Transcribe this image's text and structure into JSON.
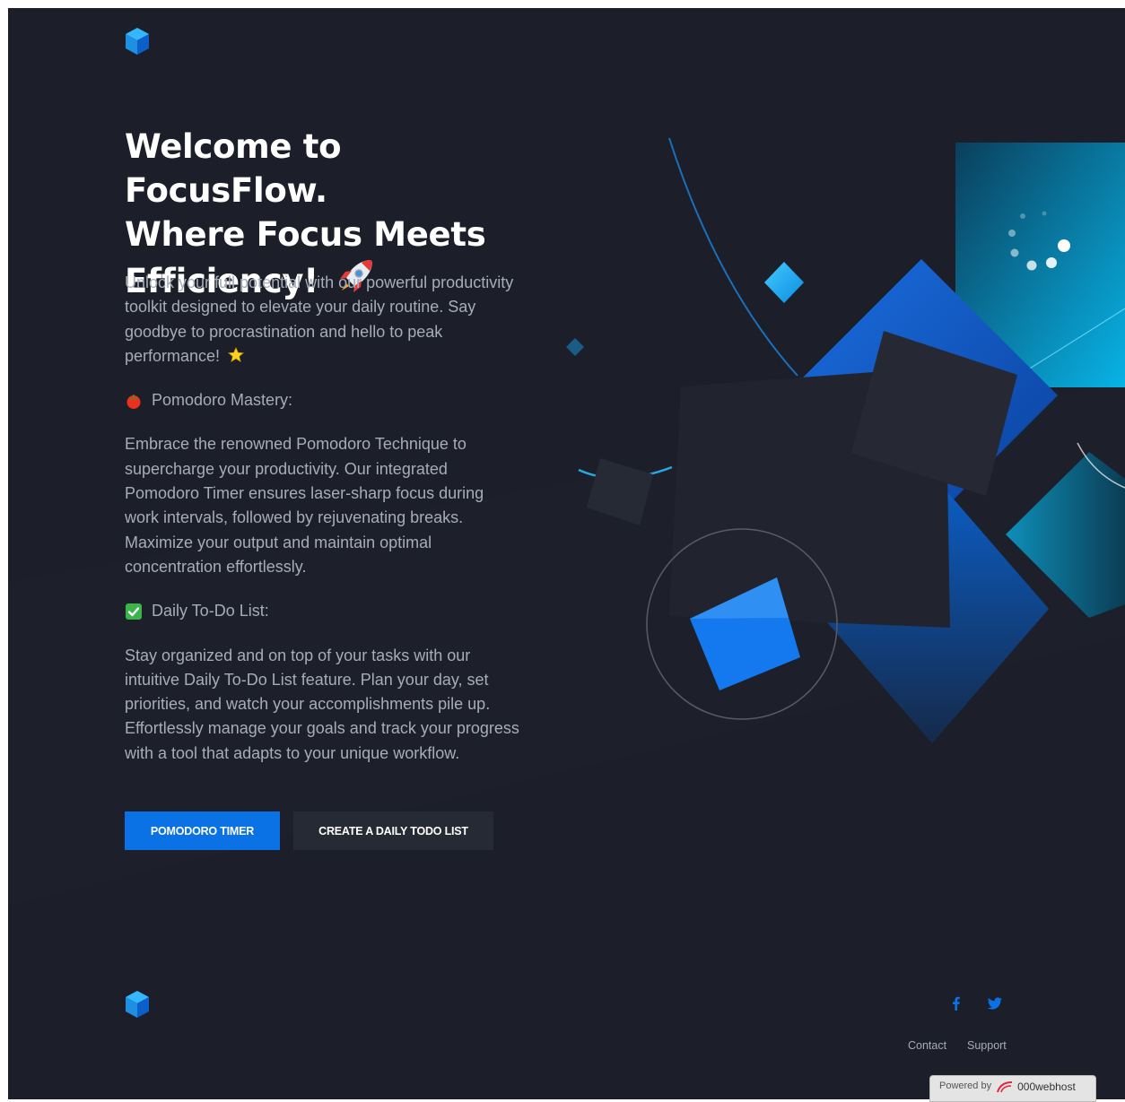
{
  "header": {
    "logo_icon": "hexagon-cube-logo"
  },
  "hero": {
    "title_line1": "Welcome to FocusFlow.",
    "title_line2": "Where Focus Meets",
    "title_line3": "Efficiency!",
    "title_emoji": "rocket-icon",
    "intro": "Unlock your full potential with our powerful productivity toolkit designed to elevate your daily routine. Say goodbye to procrastination and hello to peak performance!",
    "intro_emoji": "star-icon",
    "feature1": {
      "emoji": "tomato-icon",
      "heading": "Pomodoro Mastery:",
      "text": "Embrace the renowned Pomodoro Technique to supercharge your productivity. Our integrated Pomodoro Timer ensures laser-sharp focus during work intervals, followed by rejuvenating breaks. Maximize your output and maintain optimal concentration effortlessly."
    },
    "feature2": {
      "emoji": "check-box-icon",
      "heading": "Daily To-Do List:",
      "text": "Stay organized and on top of your tasks with our intuitive Daily To-Do List feature. Plan your day, set priorities, and watch your accomplishments pile up. Effortlessly manage your goals and track your progress with a tool that adapts to your unique workflow."
    },
    "buttons": {
      "primary": "POMODORO TIMER",
      "secondary": "CREATE A DAILY TODO LIST"
    }
  },
  "footer": {
    "social": [
      "facebook-icon",
      "twitter-icon"
    ],
    "links": {
      "contact": "Contact",
      "support": "Support"
    },
    "badge": {
      "prefix": "Powered by",
      "brand": "000webhost"
    }
  },
  "colors": {
    "background": "#1c1f29",
    "accent": "#0b72e6",
    "secondary_button": "#262a35",
    "text_muted": "#a6acb8"
  }
}
